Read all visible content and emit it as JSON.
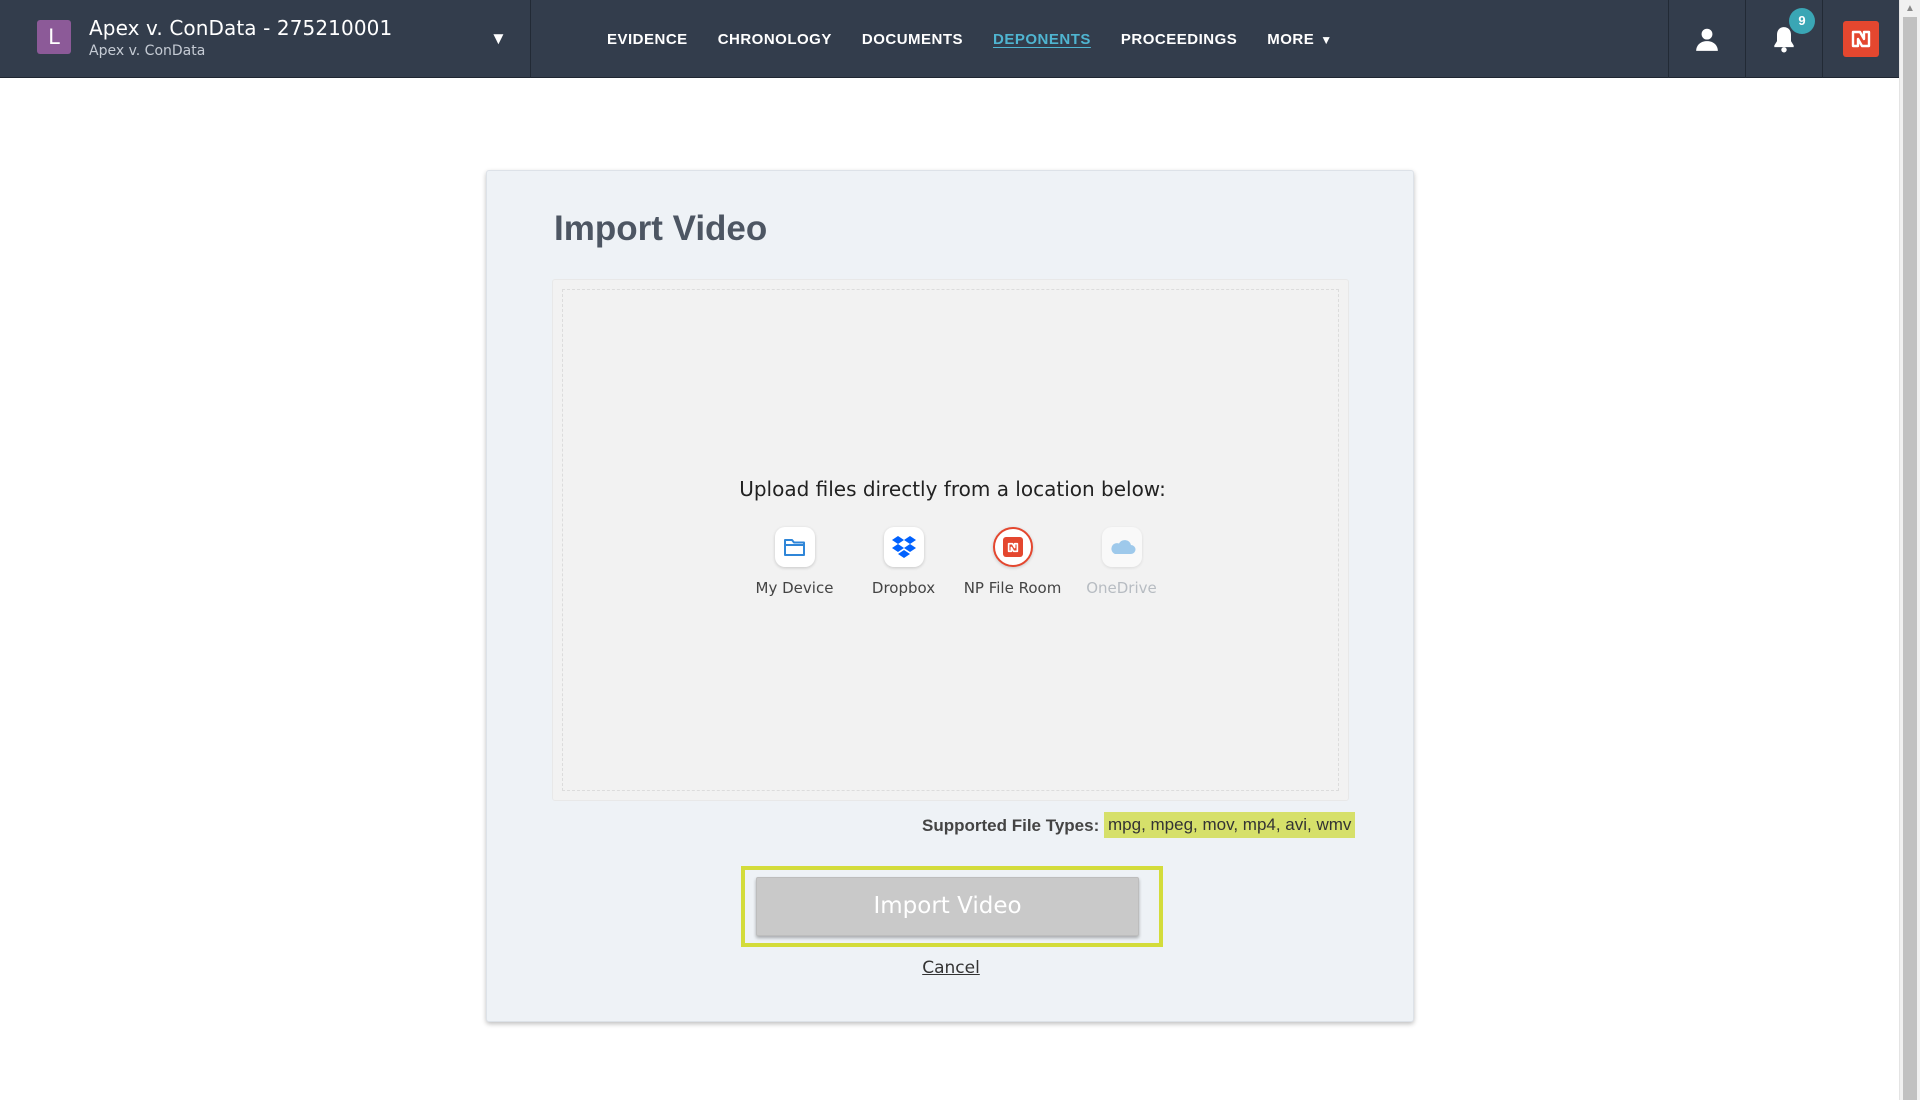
{
  "header": {
    "case_initial": "L",
    "case_title": "Apex v. ConData - 275210001",
    "case_subtitle": "Apex v. ConData",
    "nav": [
      {
        "label": "EVIDENCE",
        "active": false
      },
      {
        "label": "CHRONOLOGY",
        "active": false
      },
      {
        "label": "DOCUMENTS",
        "active": false
      },
      {
        "label": "DEPONENTS",
        "active": true
      },
      {
        "label": "PROCEEDINGS",
        "active": false
      },
      {
        "label": "MORE",
        "active": false
      }
    ],
    "more_caret": "▼",
    "case_caret": "▼",
    "notification_count": "9",
    "icons": {
      "profile": "user-icon",
      "notifications": "bell-icon",
      "brand": "np-logo-icon"
    },
    "colors": {
      "background": "#333d4c",
      "active_link": "#4fb5d1",
      "brand": "#e4472f",
      "badge": "#3aa6b5",
      "avatar": "#8c5a98"
    }
  },
  "dialog": {
    "title": "Import Video",
    "upload_prompt": "Upload files directly from a location below:",
    "sources": [
      {
        "label": "My Device",
        "icon": "folder-icon",
        "enabled": true
      },
      {
        "label": "Dropbox",
        "icon": "dropbox-icon",
        "enabled": true
      },
      {
        "label": "NP File Room",
        "icon": "np-file-room-icon",
        "enabled": true
      },
      {
        "label": "OneDrive",
        "icon": "onedrive-icon",
        "enabled": false
      }
    ],
    "supported_label": "Supported File Types:",
    "supported_types": "mpg, mpeg, mov, mp4, avi, wmv",
    "import_button": "Import Video",
    "cancel_link": "Cancel",
    "colors": {
      "highlight": "#d6e06a",
      "button_outline": "#d3dc3a",
      "button_disabled": "#c9c9c9"
    }
  }
}
